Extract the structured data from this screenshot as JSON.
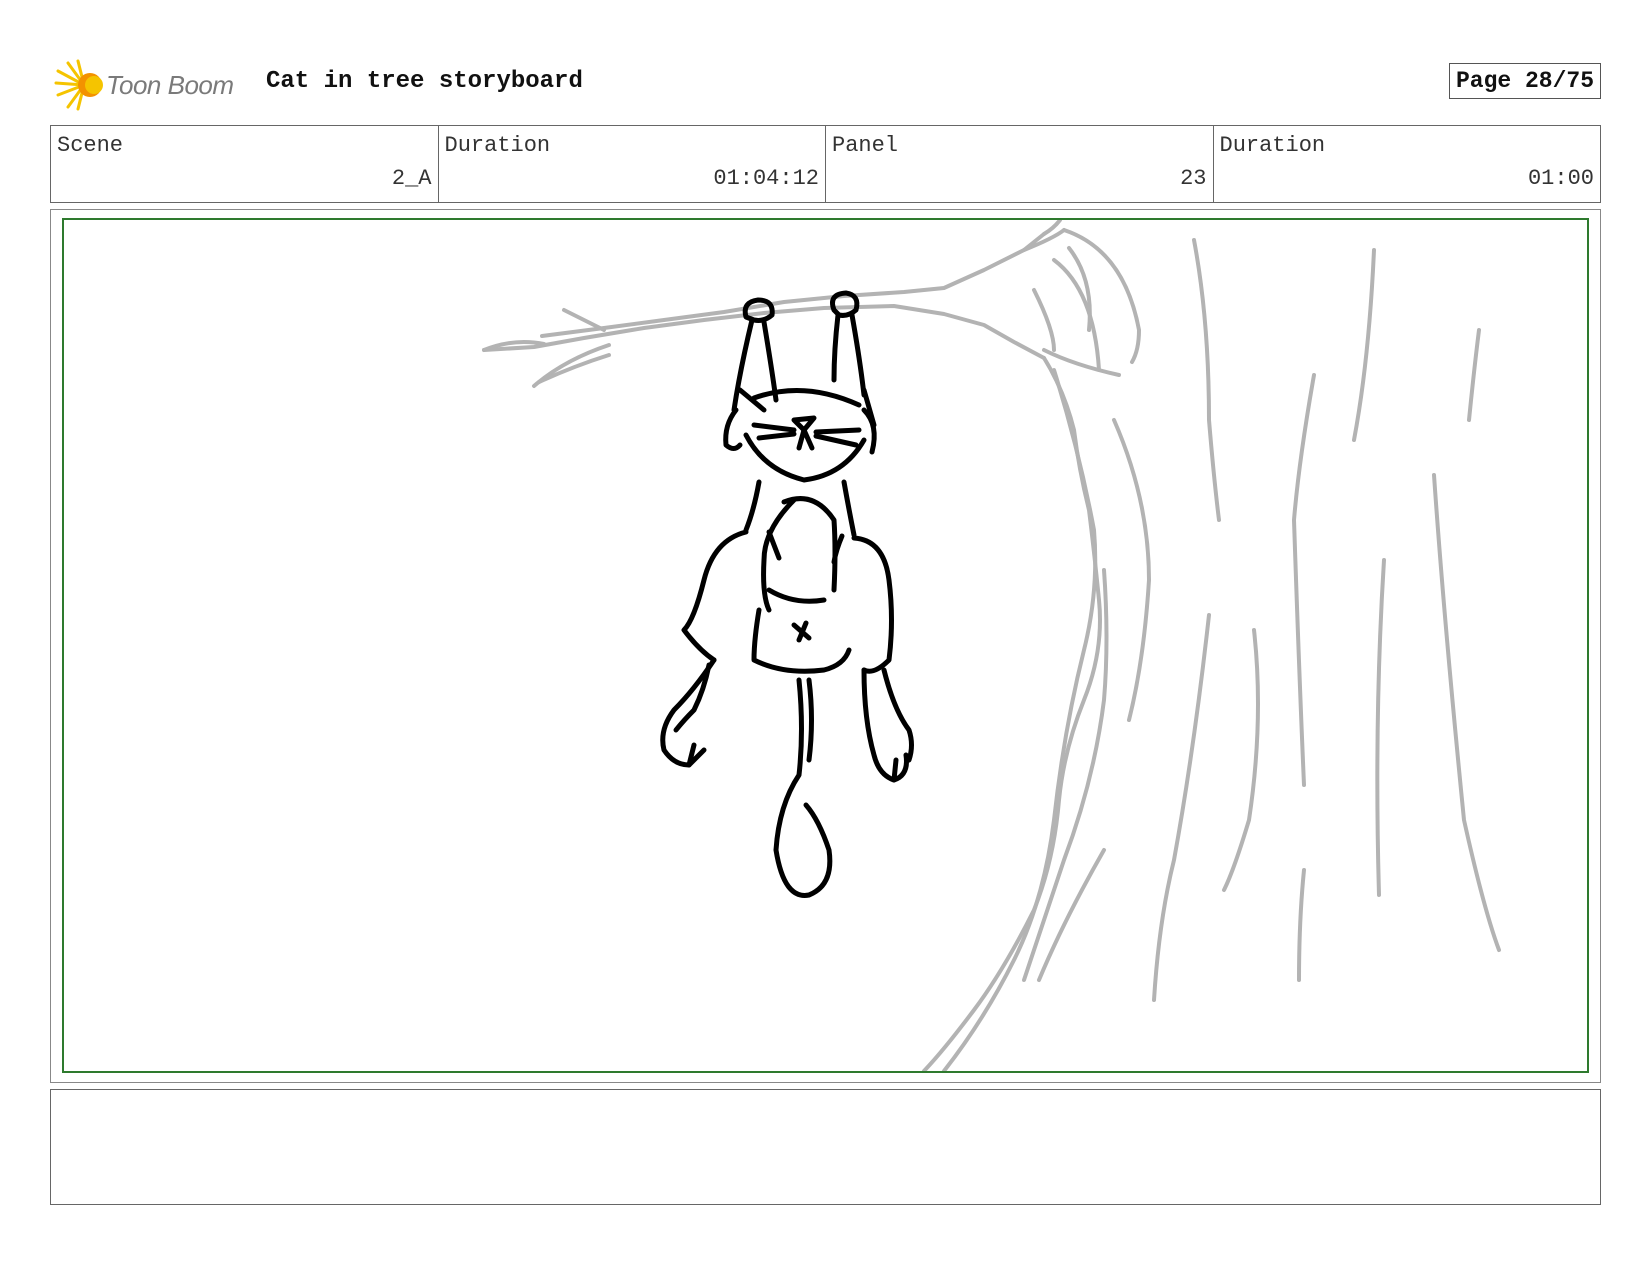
{
  "header": {
    "logo_text": "Toon Boom",
    "title": "Cat in tree storyboard",
    "page": "Page 28/75"
  },
  "info": {
    "scene_label": "Scene",
    "scene_value": "2_A",
    "scene_duration_label": "Duration",
    "scene_duration_value": "01:04:12",
    "panel_label": "Panel",
    "panel_value": "23",
    "panel_duration_label": "Duration",
    "panel_duration_value": "01:00"
  },
  "panel": {
    "frame_color": "#2e7a2e",
    "sketch_colors": {
      "background_lines": "#b3b3b3",
      "character_lines": "#000000"
    }
  },
  "notes": {
    "text": ""
  },
  "colors": {
    "logo_yellow": "#f5c400",
    "logo_orange": "#f39200"
  }
}
